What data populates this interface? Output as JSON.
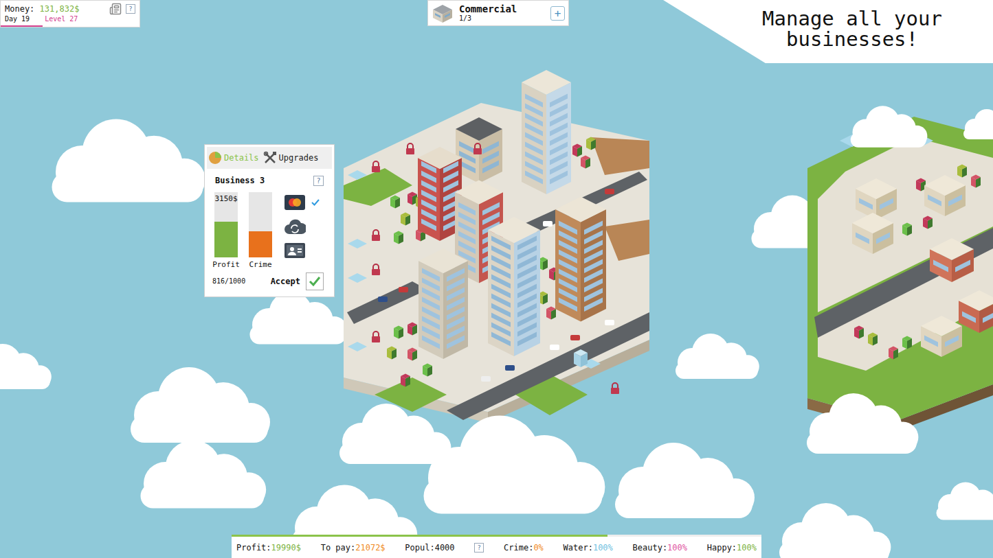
{
  "hud": {
    "money_label": "Money:",
    "money": "131,832$",
    "day": "Day 19",
    "level": "Level 27",
    "level_progress": 0.3,
    "help": "?"
  },
  "zone_selector": {
    "name": "Commercial",
    "count": "1/3",
    "add": "+"
  },
  "banner": "Manage all your businesses!",
  "business_panel": {
    "tabs": [
      {
        "label": "Details",
        "selected": true
      },
      {
        "label": "Upgrades",
        "selected": false
      }
    ],
    "title": "Business 3",
    "help": "?",
    "meters": [
      {
        "label": "Profit",
        "reading": "3150$",
        "level": 0.55,
        "color": "#7cb342"
      },
      {
        "label": "Crime",
        "level": 0.4,
        "color": "#e8711c"
      }
    ],
    "capacity": "816/1000",
    "options": [
      {
        "kind": "card",
        "checked": true
      },
      {
        "kind": "cloud",
        "checked": false
      },
      {
        "kind": "id-card",
        "checked": false
      }
    ],
    "accept": "Accept"
  },
  "status_bar": {
    "day_progress": 0.71,
    "help": "?",
    "stats": [
      {
        "label": "Profit:",
        "value": "19990$",
        "color": "#7cb342"
      },
      {
        "label": "To pay:",
        "value": "21072$",
        "color": "#f08a24"
      },
      {
        "label": "Popul:",
        "value": "4000",
        "color": "#111111"
      }
    ],
    "indicators": [
      {
        "label": "Crime:",
        "value": "0%",
        "color": "#f08a24"
      },
      {
        "label": "Water:",
        "value": "100%",
        "color": "#6fbfe0"
      },
      {
        "label": "Beauty:",
        "value": "100%",
        "color": "#e0559f"
      },
      {
        "label": "Happy:",
        "value": "100%",
        "color": "#7cb342"
      }
    ]
  }
}
